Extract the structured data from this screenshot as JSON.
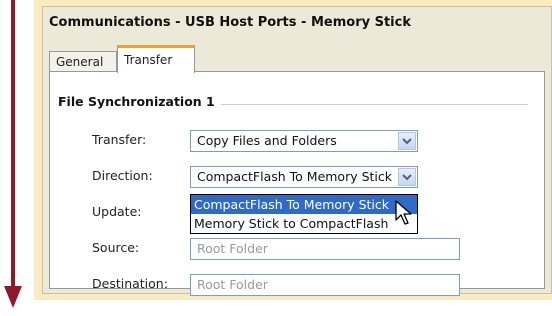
{
  "window": {
    "title": "Communications - USB Host Ports - Memory Stick"
  },
  "tabs": [
    {
      "label": "General",
      "active": false
    },
    {
      "label": "Transfer",
      "active": true
    }
  ],
  "group": {
    "title": "File Synchronization 1"
  },
  "form": {
    "transfer_label": "Transfer:",
    "transfer_value": "Copy Files and Folders",
    "direction_label": "Direction:",
    "direction_value": "CompactFlash To Memory Stick",
    "direction_options": [
      "CompactFlash To Memory Stick",
      "Memory Stick to CompactFlash"
    ],
    "update_label": "Update:",
    "source_label": "Source:",
    "source_placeholder": "Root Folder",
    "destination_label": "Destination:",
    "destination_placeholder": "Root Folder"
  },
  "colors": {
    "arrow": "#8b1a2b",
    "frame": "#f9ecc0",
    "tab_accent": "#e8a33d",
    "selection": "#316ac5"
  },
  "icons": {
    "dropdown": "chevron-down-icon",
    "cursor": "mouse-pointer-icon",
    "flow_arrow": "down-arrow-icon"
  }
}
